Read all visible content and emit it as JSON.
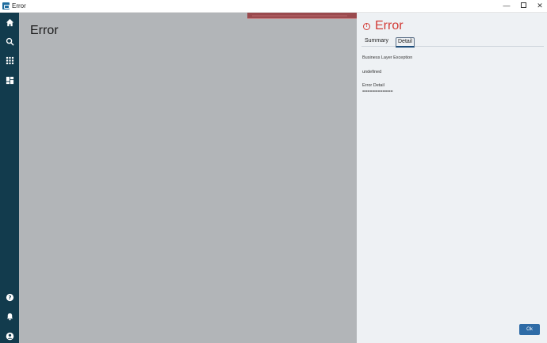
{
  "window": {
    "title": "Error",
    "minimize": "—",
    "close": "✕"
  },
  "sidebar": {
    "top_icons": [
      "home-icon",
      "search-icon",
      "apps-grid-icon",
      "dashboard-icon"
    ],
    "bottom_icons": [
      "help-icon",
      "bell-icon",
      "user-icon"
    ],
    "background": "#123b4d"
  },
  "main": {
    "title": "Error"
  },
  "panel": {
    "title": "Error",
    "icon": "!",
    "tabs": [
      {
        "label": "Summary",
        "active": false
      },
      {
        "label": "Detail",
        "active": true
      }
    ],
    "detail": {
      "line1": "Business Layer Exception",
      "line2": "undefined",
      "line3": "Error Detail",
      "line4": "============"
    },
    "ok_label": "Ok",
    "accent": "#d23a35",
    "button_color": "#2e6ba6"
  }
}
